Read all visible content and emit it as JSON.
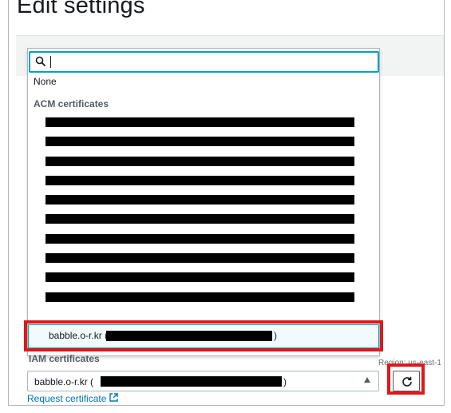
{
  "page": {
    "title": "Edit settings"
  },
  "panel": {
    "label_peek": ""
  },
  "dropdown": {
    "filter": {
      "value": "",
      "placeholder": ""
    },
    "none_option": "None",
    "groups": [
      {
        "label": "ACM certificates"
      },
      {
        "label": "IAM certificates"
      }
    ],
    "acm_rows_count_visible": 10,
    "selected_option": {
      "prefix": "babble.o-r.kr (",
      "suffix": ")"
    }
  },
  "select": {
    "prefix": "babble.o-r.kr (",
    "suffix": ")"
  },
  "region_text": "Region: us-east-1",
  "request_link": {
    "label": "Request certificate"
  },
  "icons": {
    "search": "search-icon",
    "external": "external-link-icon",
    "refresh": "refresh-icon",
    "caret": "triangle-up-icon"
  },
  "colors": {
    "focus": "#00a1c9",
    "highlight": "#e0181b",
    "link": "#0073bb",
    "selected_bg": "#f1faff"
  }
}
